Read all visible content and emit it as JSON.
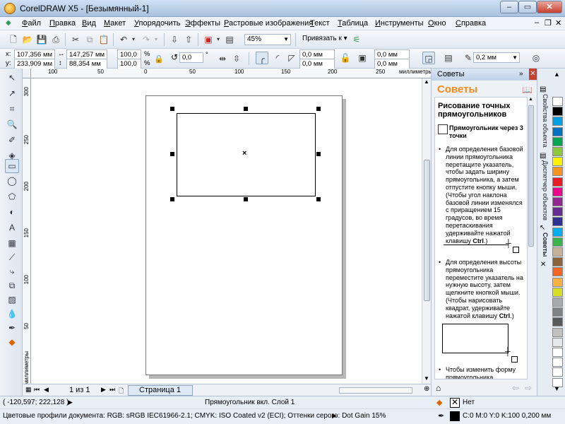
{
  "app": {
    "title": "CorelDRAW X5 - [Безымянный-1]"
  },
  "menu": [
    "Файл",
    "Правка",
    "Вид",
    "Макет",
    "Упорядочить",
    "Эффекты",
    "Растровые изображения",
    "Текст",
    "Таблица",
    "Инструменты",
    "Окно",
    "Справка"
  ],
  "toolbar": {
    "zoom": "45%",
    "snap_label": "Привязать к"
  },
  "props": {
    "x": "107,356 мм",
    "y": "233,909 мм",
    "w": "147,257 мм",
    "h": "88,354 мм",
    "scale_x": "100,0",
    "scale_y": "100,0",
    "pct": "%",
    "angle": "0,0",
    "deg": "°",
    "corner1": "0,0 мм",
    "corner2": "0,0 мм",
    "corner3": "0,0 мм",
    "corner4": "0,0 мм",
    "outline": "0,2 мм"
  },
  "ruler": {
    "h_ticks": [
      "100",
      "50",
      "0",
      "50",
      "100",
      "150",
      "200",
      "250"
    ],
    "h_unit": "миллиметры",
    "v_ticks": [
      "300",
      "250",
      "200",
      "150",
      "100",
      "50"
    ],
    "v_unit": "миллиметры"
  },
  "nav": {
    "page_count": "1 из 1",
    "page_tab": "Страница 1"
  },
  "docker": {
    "header": "Советы",
    "title": "Советы",
    "heading": "Рисование точных прямоугольников",
    "subheading": "Прямоугольник через 3 точки",
    "bullet1_a": "Для определения базовой линии прямоугольника перетащите указатель, чтобы задать ширину прямоугольника, а затем отпустите кнопку мыши. (Чтобы угол наклона базовой линии изменялся с приращением 15 градусов, во время перетаскивания удерживайте нажатой клавишу ",
    "bullet1_key": "Ctrl",
    "bullet1_b": ".)",
    "bullet2_a": "Для определения высоты прямоугольника переместите указатель на нужную высоту, затем щелкните кнопкой мыши. (Чтобы нарисовать квадрат, удерживайте нажатой клавишу ",
    "bullet2_key": "Ctrl",
    "bullet2_b": ".)",
    "bullet3": "Чтобы изменить форму прямоугольника, выберите"
  },
  "sidetabs": [
    "Свойства объекта",
    "Диспетчер объектов",
    "Советы"
  ],
  "palette": [
    "#ffffff",
    "#000000",
    "#00a0e3",
    "#0070c0",
    "#00a651",
    "#8dc63f",
    "#fff200",
    "#f7941d",
    "#ed1c24",
    "#ec008c",
    "#92278f",
    "#662d91",
    "#2e3192",
    "#00aeef",
    "#39b54a",
    "#c7b299",
    "#8c6239",
    "#f26522",
    "#fbb040",
    "#d7df23",
    "#a7a9ac",
    "#808285",
    "#58595b",
    "#c0c0c0",
    "#e6e7e8",
    "#ffffff",
    "#ffffff",
    "#ffffff",
    "#ffffff"
  ],
  "status": {
    "coords": "( -120,597; 222,128 )",
    "layer": "Прямоугольник вкл. Слой 1",
    "fill": "Нет",
    "profiles": "Цветовые профили документа: RGB: sRGB IEC61966-2.1; CMYK: ISO Coated v2 (ECI); Оттенки серого: Dot Gain 15%",
    "outline": "C:0 M:0 Y:0 K:100  0,200 мм"
  }
}
